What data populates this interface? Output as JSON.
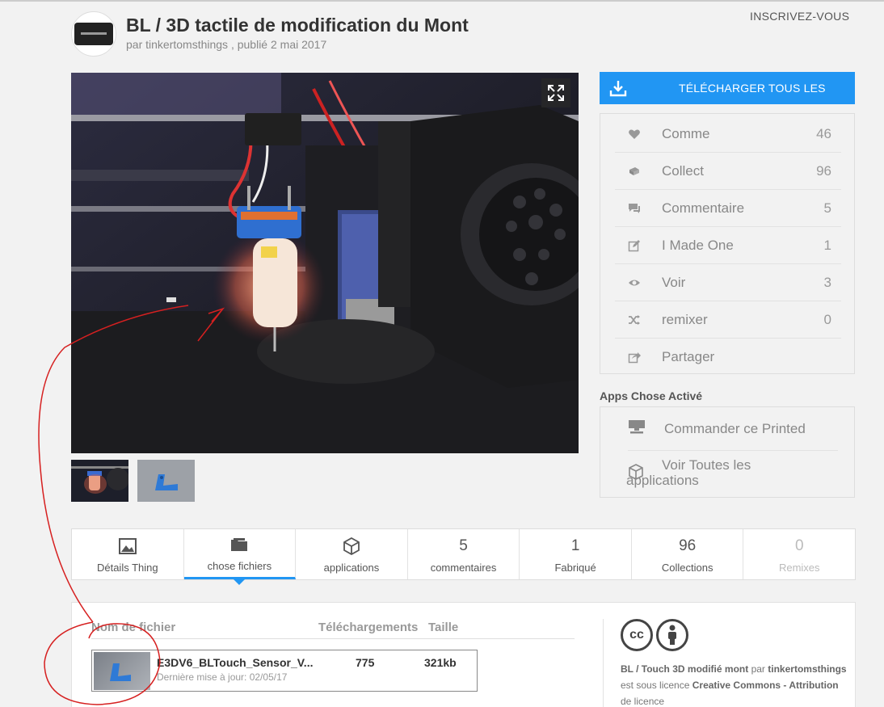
{
  "header": {
    "signup": "INSCRIVEZ-VOUS",
    "title": "BL / 3D tactile de modification du Mont",
    "author_prefix": "par",
    "author": "tinkertomsthings",
    "published": ", publié 2 mai 2017"
  },
  "media": {
    "expand_icon": "expand-icon"
  },
  "sidebar": {
    "download_label": "TÉLÉCHARGER TOUS LES",
    "download_icon": "download-icon",
    "stats": [
      {
        "icon": "heart-icon",
        "label": "Comme",
        "count": "46"
      },
      {
        "icon": "collect-icon",
        "label": "Collect",
        "count": "96"
      },
      {
        "icon": "comment-icon",
        "label": "Commentaire",
        "count": "5"
      },
      {
        "icon": "pencil-icon",
        "label": "I Made One",
        "count": "1"
      },
      {
        "icon": "eye-icon",
        "label": "Voir",
        "count": "3"
      },
      {
        "icon": "shuffle-icon",
        "label": "remixer",
        "count": "0"
      },
      {
        "icon": "share-icon",
        "label": "Partager",
        "count": ""
      }
    ],
    "apps_heading": "Apps Chose Activé",
    "apps": [
      {
        "icon": "printer-icon",
        "label": "Commander ce Printed"
      },
      {
        "icon": "cube-icon",
        "label": "Voir Toutes les",
        "label2": "applications"
      }
    ]
  },
  "tabs": [
    {
      "kind": "icon",
      "icon": "image-icon",
      "label": "Détails Thing"
    },
    {
      "kind": "icon",
      "icon": "folder-icon",
      "label": "chose fichiers",
      "active": true
    },
    {
      "kind": "icon",
      "icon": "cube-icon",
      "label": "applications"
    },
    {
      "kind": "num",
      "value": "5",
      "label": "commentaires"
    },
    {
      "kind": "num",
      "value": "1",
      "label": "Fabriqué"
    },
    {
      "kind": "num",
      "value": "96",
      "label": "Collections"
    },
    {
      "kind": "num",
      "value": "0",
      "label": "Remixes",
      "dim": true
    }
  ],
  "files": {
    "col_name": "Nom de fichier",
    "col_downloads": "Téléchargements",
    "col_size": "Taille",
    "rows": [
      {
        "name": "E3DV6_BLTouch_Sensor_V...",
        "updated": "Dernière mise à jour: 02/05/17",
        "downloads": "775",
        "size": "321kb"
      }
    ]
  },
  "license": {
    "icons": [
      "cc-icon",
      "attribution-icon"
    ],
    "cc_text": "cc",
    "thing": "BL / Touch 3D modifié mont",
    "par": "par",
    "author": "tinkertomsthings",
    "text": "est sous licence",
    "license_name": "Creative Commons - Attribution",
    "cut": "de licence"
  },
  "colors": {
    "accent": "#2196f3",
    "annotation": "#d62020"
  }
}
